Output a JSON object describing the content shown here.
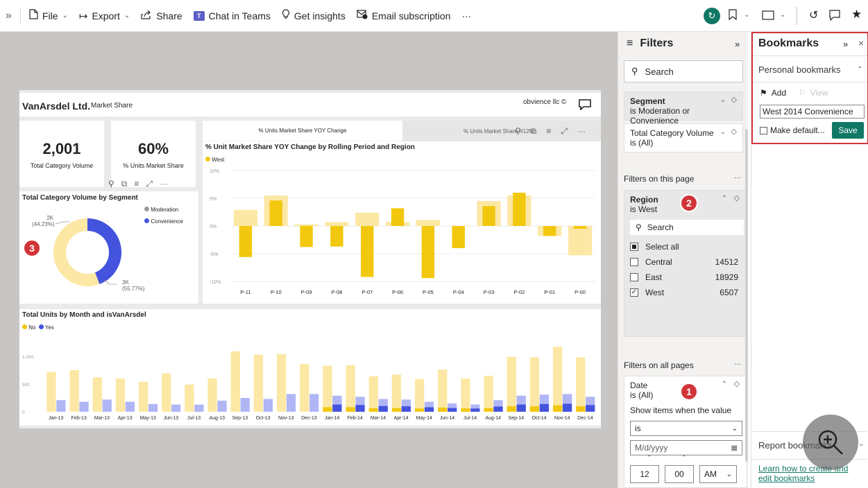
{
  "toolbar": {
    "expand": "»",
    "file": "File",
    "export": "Export",
    "share": "Share",
    "teams": "Chat in Teams",
    "insights": "Get insights",
    "email": "Email subscription",
    "more": "···"
  },
  "report": {
    "company": "VanArsdel Ltd.",
    "subtitle": "Market Share",
    "credit": "obvience llc ©",
    "kpis": [
      {
        "value": "2,001",
        "label": "Total Category Volume"
      },
      {
        "value": "60%",
        "label": "% Units Market Share"
      }
    ],
    "donut": {
      "title": "Total Category Volume by Segment",
      "legend": [
        "Moderation",
        "Convenience"
      ],
      "label_top": "2K",
      "label_top_pct": "(44.23%)",
      "label_bottom": "3K",
      "label_bottom_pct": "(55.77%)"
    },
    "tabs": [
      "% Units Market Share YOY Change",
      "% Units Market Share R12M"
    ],
    "yoy": {
      "title": "% Unit Market Share YOY Change by Rolling Period and Region",
      "legend": "West"
    },
    "monthly": {
      "title": "Total Units by Month and isVanArsdel",
      "legend_no": "No",
      "legend_yes": "Yes"
    }
  },
  "chart_data": [
    {
      "type": "pie",
      "title": "Total Category Volume by Segment",
      "labels": [
        "Moderation",
        "Convenience"
      ],
      "values": [
        44.23,
        55.77
      ],
      "colors": [
        "#4453dd",
        "#fce8a4"
      ]
    },
    {
      "type": "bar",
      "title": "% Unit Market Share YOY Change by Rolling Period and Region",
      "categories": [
        "P-11",
        "P-10",
        "P-09",
        "P-08",
        "P-07",
        "P-06",
        "P-05",
        "P-04",
        "P-03",
        "P-02",
        "P-01",
        "P-00"
      ],
      "series": [
        {
          "name": "West",
          "values": [
            -5.6,
            4.6,
            -3.8,
            -3.7,
            -9.2,
            3.2,
            -9.4,
            -4.0,
            3.6,
            6.0,
            -1.8,
            -0.5
          ]
        },
        {
          "values": [
            2.9,
            5.5,
            0.3,
            0.7,
            2.4,
            0.7,
            1.1,
            0.0,
            4.5,
            5.5,
            -1.8,
            -5.3
          ]
        }
      ],
      "ylabel": "",
      "ylim": [
        -10,
        10
      ],
      "yticks": [
        "10%",
        "5%",
        "0%",
        "-5%",
        "-10%"
      ]
    },
    {
      "type": "bar",
      "title": "Total Units by Month and isVanArsdel",
      "categories": [
        "Jan-13",
        "Feb-13",
        "Mar-13",
        "Apr-13",
        "May-13",
        "Jun-13",
        "Jul-13",
        "Aug-13",
        "Sep-13",
        "Oct-13",
        "Nov-13",
        "Dec-13",
        "Jan-14",
        "Feb-14",
        "Mar-14",
        "Apr-14",
        "May-14",
        "Jun-14",
        "Jul-14",
        "Aug-14",
        "Sep-14",
        "Oct-14",
        "Nov-14",
        "Dec-14"
      ],
      "series": [
        {
          "name": "No",
          "values": [
            720,
            750,
            620,
            600,
            540,
            690,
            490,
            600,
            1090,
            1030,
            1040,
            860,
            830,
            840,
            640,
            670,
            590,
            760,
            600,
            650,
            990,
            980,
            1170,
            980
          ]
        },
        {
          "name": "Yes",
          "values": [
            210,
            180,
            220,
            180,
            140,
            130,
            130,
            200,
            250,
            230,
            320,
            320,
            290,
            270,
            230,
            220,
            180,
            150,
            130,
            210,
            290,
            310,
            320,
            270
          ]
        }
      ],
      "ylim": [
        0,
        1200
      ],
      "yticks": [
        "1,000",
        "500",
        "0"
      ]
    }
  ],
  "filters": {
    "title": "Filters",
    "search": "Search",
    "segment_title": "Segment",
    "segment_value": "is Moderation or Convenience",
    "tcv_title": "Total Category Volume",
    "tcv_value": "is (All)",
    "page_header": "Filters on this page",
    "region_title": "Region",
    "region_value": "is West",
    "region_search": "Search",
    "select_all": "Select all",
    "items": [
      {
        "label": "Central",
        "count": "14512"
      },
      {
        "label": "East",
        "count": "18929"
      },
      {
        "label": "West",
        "count": "6507"
      }
    ],
    "all_pages_header": "Filters on all pages",
    "date_title": "Date",
    "date_value": "is (All)",
    "show_items": "Show items when the value",
    "operator": "is",
    "date_placeholder": "M/d/yyyy",
    "hour": "12",
    "minute": "00",
    "ampm": "AM"
  },
  "bookmarks": {
    "title": "Bookmarks",
    "personal": "Personal bookmarks",
    "add": "Add",
    "view": "View",
    "name_value": "West 2014 Convenience",
    "make_default": "Make default...",
    "save": "Save",
    "report_bookmarks": "Report bookmarks",
    "learn": "Learn how to create and edit bookmarks"
  },
  "badges": [
    "1",
    "2",
    "3"
  ],
  "colors": {
    "accent_green": "#117865",
    "highlight_red": "#d13438",
    "gold": "#f2c80f",
    "light_gold": "#fce8a4",
    "blue": "#4453dd",
    "light_blue": "#b0b6f5"
  }
}
